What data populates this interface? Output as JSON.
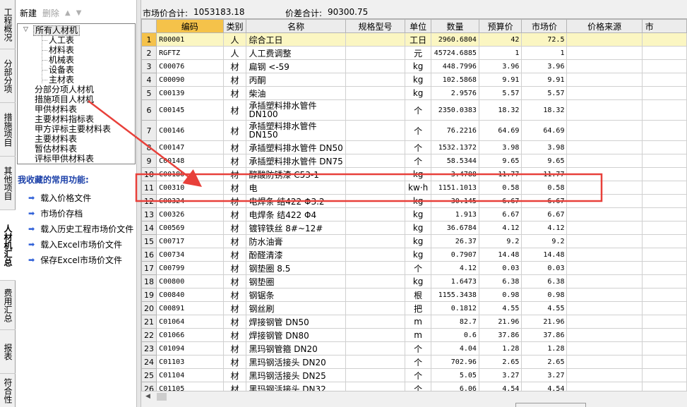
{
  "vtabs": [
    {
      "label": "工程概况",
      "active": false
    },
    {
      "label": "分部分项",
      "active": false
    },
    {
      "label": "措施项目",
      "active": false
    },
    {
      "label": "其他项目",
      "active": false
    },
    {
      "label": "人材机汇总",
      "active": true
    },
    {
      "label": "费用汇总",
      "active": false
    },
    {
      "label": "报表",
      "active": false
    },
    {
      "label": "符合性",
      "active": false
    }
  ],
  "tree_toolbar": {
    "new_label": "新建",
    "delete_label": "删除"
  },
  "tree": {
    "root": "所有人材机",
    "children": [
      "人工表",
      "材料表",
      "机械表",
      "设备表",
      "主材表"
    ],
    "others": [
      "分部分项人材机",
      "措施项目人材机",
      "甲供材料表",
      "主要材料指标表",
      "甲方评标主要材料表",
      "主要材料表",
      "暂估材料表",
      "评标甲供材料表"
    ]
  },
  "favorites": {
    "title": "我收藏的常用功能:",
    "items": [
      "载入价格文件",
      "市场价存档",
      "载入历史工程市场价文件",
      "载入Excel市场价文件",
      "保存Excel市场价文件"
    ]
  },
  "info": {
    "market_total_label": "市场价合计:",
    "market_total": "1053183.18",
    "diff_total_label": "价差合计:",
    "diff_total": "90300.75"
  },
  "table": {
    "headers": [
      "编码",
      "类别",
      "名称",
      "规格型号",
      "单位",
      "数量",
      "预算价",
      "市场价",
      "价格来源",
      "市"
    ],
    "rows": [
      [
        "1",
        "R00001",
        "人",
        "综合工日",
        "",
        "工日",
        "2960.6804",
        "42",
        "72.5"
      ],
      [
        "2",
        "RGFTZ",
        "人",
        "人工费调整",
        "",
        "元",
        "45724.6885",
        "1",
        "1"
      ],
      [
        "3",
        "C00076",
        "材",
        "扁钢 <-59",
        "",
        "kg",
        "448.7996",
        "3.96",
        "3.96"
      ],
      [
        "4",
        "C00090",
        "材",
        "丙酮",
        "",
        "kg",
        "102.5868",
        "9.91",
        "9.91"
      ],
      [
        "5",
        "C00139",
        "材",
        "柴油",
        "",
        "kg",
        "2.9576",
        "5.57",
        "5.57"
      ],
      [
        "6",
        "C00145",
        "材",
        "承插塑料排水管件 DN100",
        "",
        "个",
        "2350.0383",
        "18.32",
        "18.32"
      ],
      [
        "7",
        "C00146",
        "材",
        "承插塑料排水管件 DN150",
        "",
        "个",
        "76.2216",
        "64.69",
        "64.69"
      ],
      [
        "8",
        "C00147",
        "材",
        "承插塑料排水管件 DN50",
        "",
        "个",
        "1532.1372",
        "3.98",
        "3.98"
      ],
      [
        "9",
        "C00148",
        "材",
        "承插塑料排水管件 DN75",
        "",
        "个",
        "58.5344",
        "9.65",
        "9.65"
      ],
      [
        "10",
        "C00180",
        "材",
        "醇酸防锈漆 C53-1",
        "",
        "kg",
        "3.4788",
        "11.77",
        "11.77"
      ],
      [
        "11",
        "C00310",
        "材",
        "电",
        "",
        "kw·h",
        "1151.1013",
        "0.58",
        "0.58"
      ],
      [
        "12",
        "C00324",
        "材",
        "电焊条 结422 Φ3.2",
        "",
        "kg",
        "30.145",
        "6.67",
        "6.67"
      ],
      [
        "13",
        "C00326",
        "材",
        "电焊条 结422 Φ4",
        "",
        "kg",
        "1.913",
        "6.67",
        "6.67"
      ],
      [
        "14",
        "C00569",
        "材",
        "镀锌铁丝 8#~12#",
        "",
        "kg",
        "36.6784",
        "4.12",
        "4.12"
      ],
      [
        "15",
        "C00717",
        "材",
        "防水油膏",
        "",
        "kg",
        "26.37",
        "9.2",
        "9.2"
      ],
      [
        "16",
        "C00734",
        "材",
        "酚醛清漆",
        "",
        "kg",
        "0.7907",
        "14.48",
        "14.48"
      ],
      [
        "17",
        "C00799",
        "材",
        "钢垫圈 8.5",
        "",
        "个",
        "4.12",
        "0.03",
        "0.03"
      ],
      [
        "18",
        "C00800",
        "材",
        "钢垫圈",
        "",
        "kg",
        "1.6473",
        "6.38",
        "6.38"
      ],
      [
        "19",
        "C00840",
        "材",
        "钢锯条",
        "",
        "根",
        "1155.3438",
        "0.98",
        "0.98"
      ],
      [
        "20",
        "C00891",
        "材",
        "钢丝刷",
        "",
        "把",
        "0.1812",
        "4.55",
        "4.55"
      ],
      [
        "21",
        "C01064",
        "材",
        "焊接钢管 DN50",
        "",
        "m",
        "82.7",
        "21.96",
        "21.96"
      ],
      [
        "22",
        "C01066",
        "材",
        "焊接钢管 DN80",
        "",
        "m",
        "0.6",
        "37.86",
        "37.86"
      ],
      [
        "23",
        "C01094",
        "材",
        "黑玛钢管箍 DN20",
        "",
        "个",
        "4.04",
        "1.28",
        "1.28"
      ],
      [
        "24",
        "C01103",
        "材",
        "黑玛钢活接头 DN20",
        "",
        "个",
        "702.96",
        "2.65",
        "2.65"
      ],
      [
        "25",
        "C01104",
        "材",
        "黑玛钢活接头 DN25",
        "",
        "个",
        "5.05",
        "3.27",
        "3.27"
      ],
      [
        "26",
        "C01105",
        "材",
        "黑玛钢活接头 DN32",
        "",
        "个",
        "6.06",
        "4.54",
        "4.54"
      ]
    ]
  },
  "colors": {
    "header_highlight": "#f5c24a",
    "annotation": "#e8403a",
    "favorites_title": "#1a3fa8"
  }
}
